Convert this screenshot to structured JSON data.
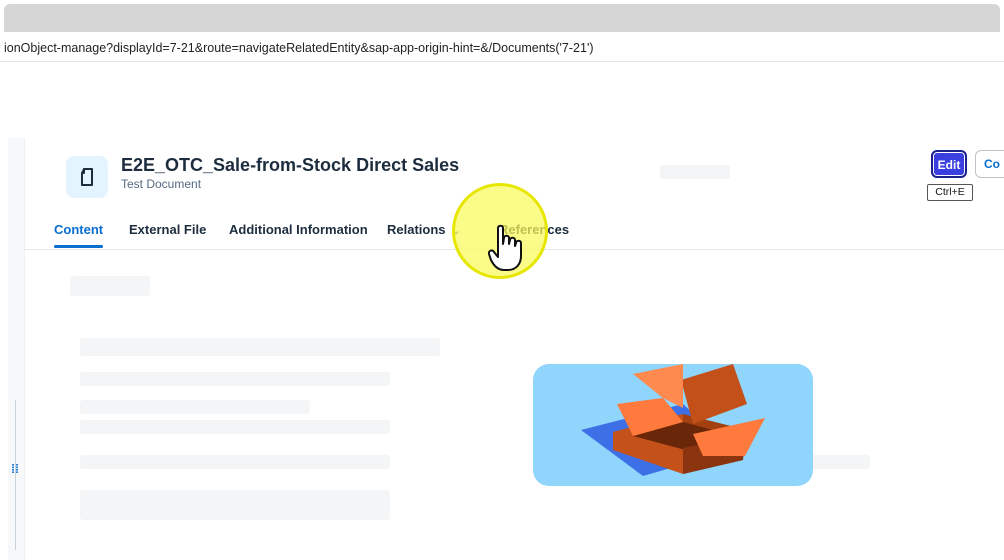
{
  "browser": {
    "url": "ionObject-manage?displayId=7-21&route=navigateRelatedEntity&sap-app-origin-hint=&/Documents('7-21')"
  },
  "header": {
    "title": "E2E_OTC_Sale-from-Stock Direct Sales",
    "subtitle": "Test Document",
    "icon": "document-icon"
  },
  "actions": {
    "edit_label": "Edit",
    "copy_label": "Co",
    "edit_shortcut": "Ctrl+E"
  },
  "tabs": [
    {
      "label": "Content",
      "active": true
    },
    {
      "label": "External File",
      "active": false
    },
    {
      "label": "Additional Information",
      "active": false
    },
    {
      "label": "Relations",
      "active": false
    },
    {
      "label": "References",
      "active": false
    }
  ],
  "content": {
    "empty_state_icon": "open-box-illustration"
  },
  "colors": {
    "accent": "#0a6ed1",
    "edit_button": "#3a3fe0",
    "icon_bg": "#e4f4ff",
    "highlight": "#fafa5a"
  }
}
